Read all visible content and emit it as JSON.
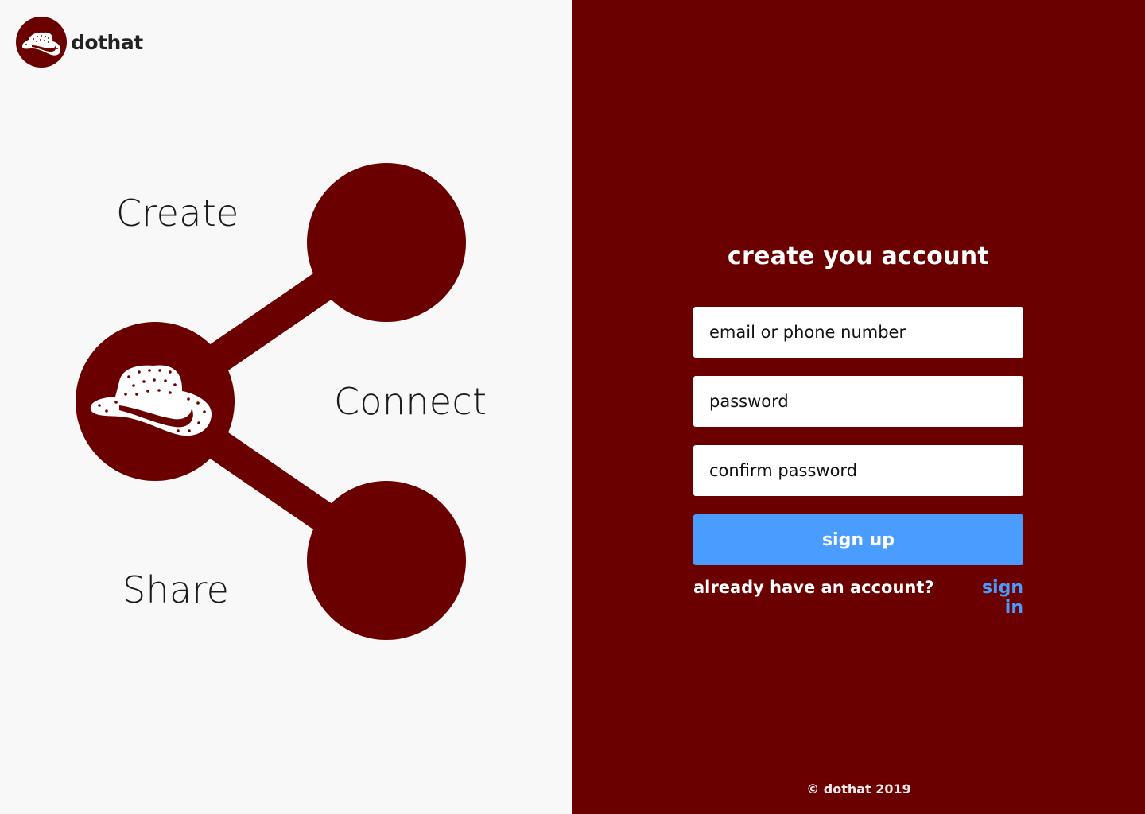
{
  "brand": {
    "name": "dothat",
    "logo_icon": "hat-icon",
    "primary_color": "#6a0000",
    "accent_color": "#4a9dff",
    "background_color": "#f8f8f8"
  },
  "hero": {
    "words": {
      "create": "Create",
      "connect": "Connect",
      "share": "Share"
    },
    "graphic_icon": "share-icon"
  },
  "form": {
    "title": "create you account",
    "email_placeholder": "email or phone number",
    "password_placeholder": "password",
    "confirm_placeholder": "confirm password",
    "submit_label": "sign up",
    "already_text": "already have an account?",
    "signin_label": "sign in"
  },
  "footer": {
    "copyright": "© dothat 2019"
  }
}
